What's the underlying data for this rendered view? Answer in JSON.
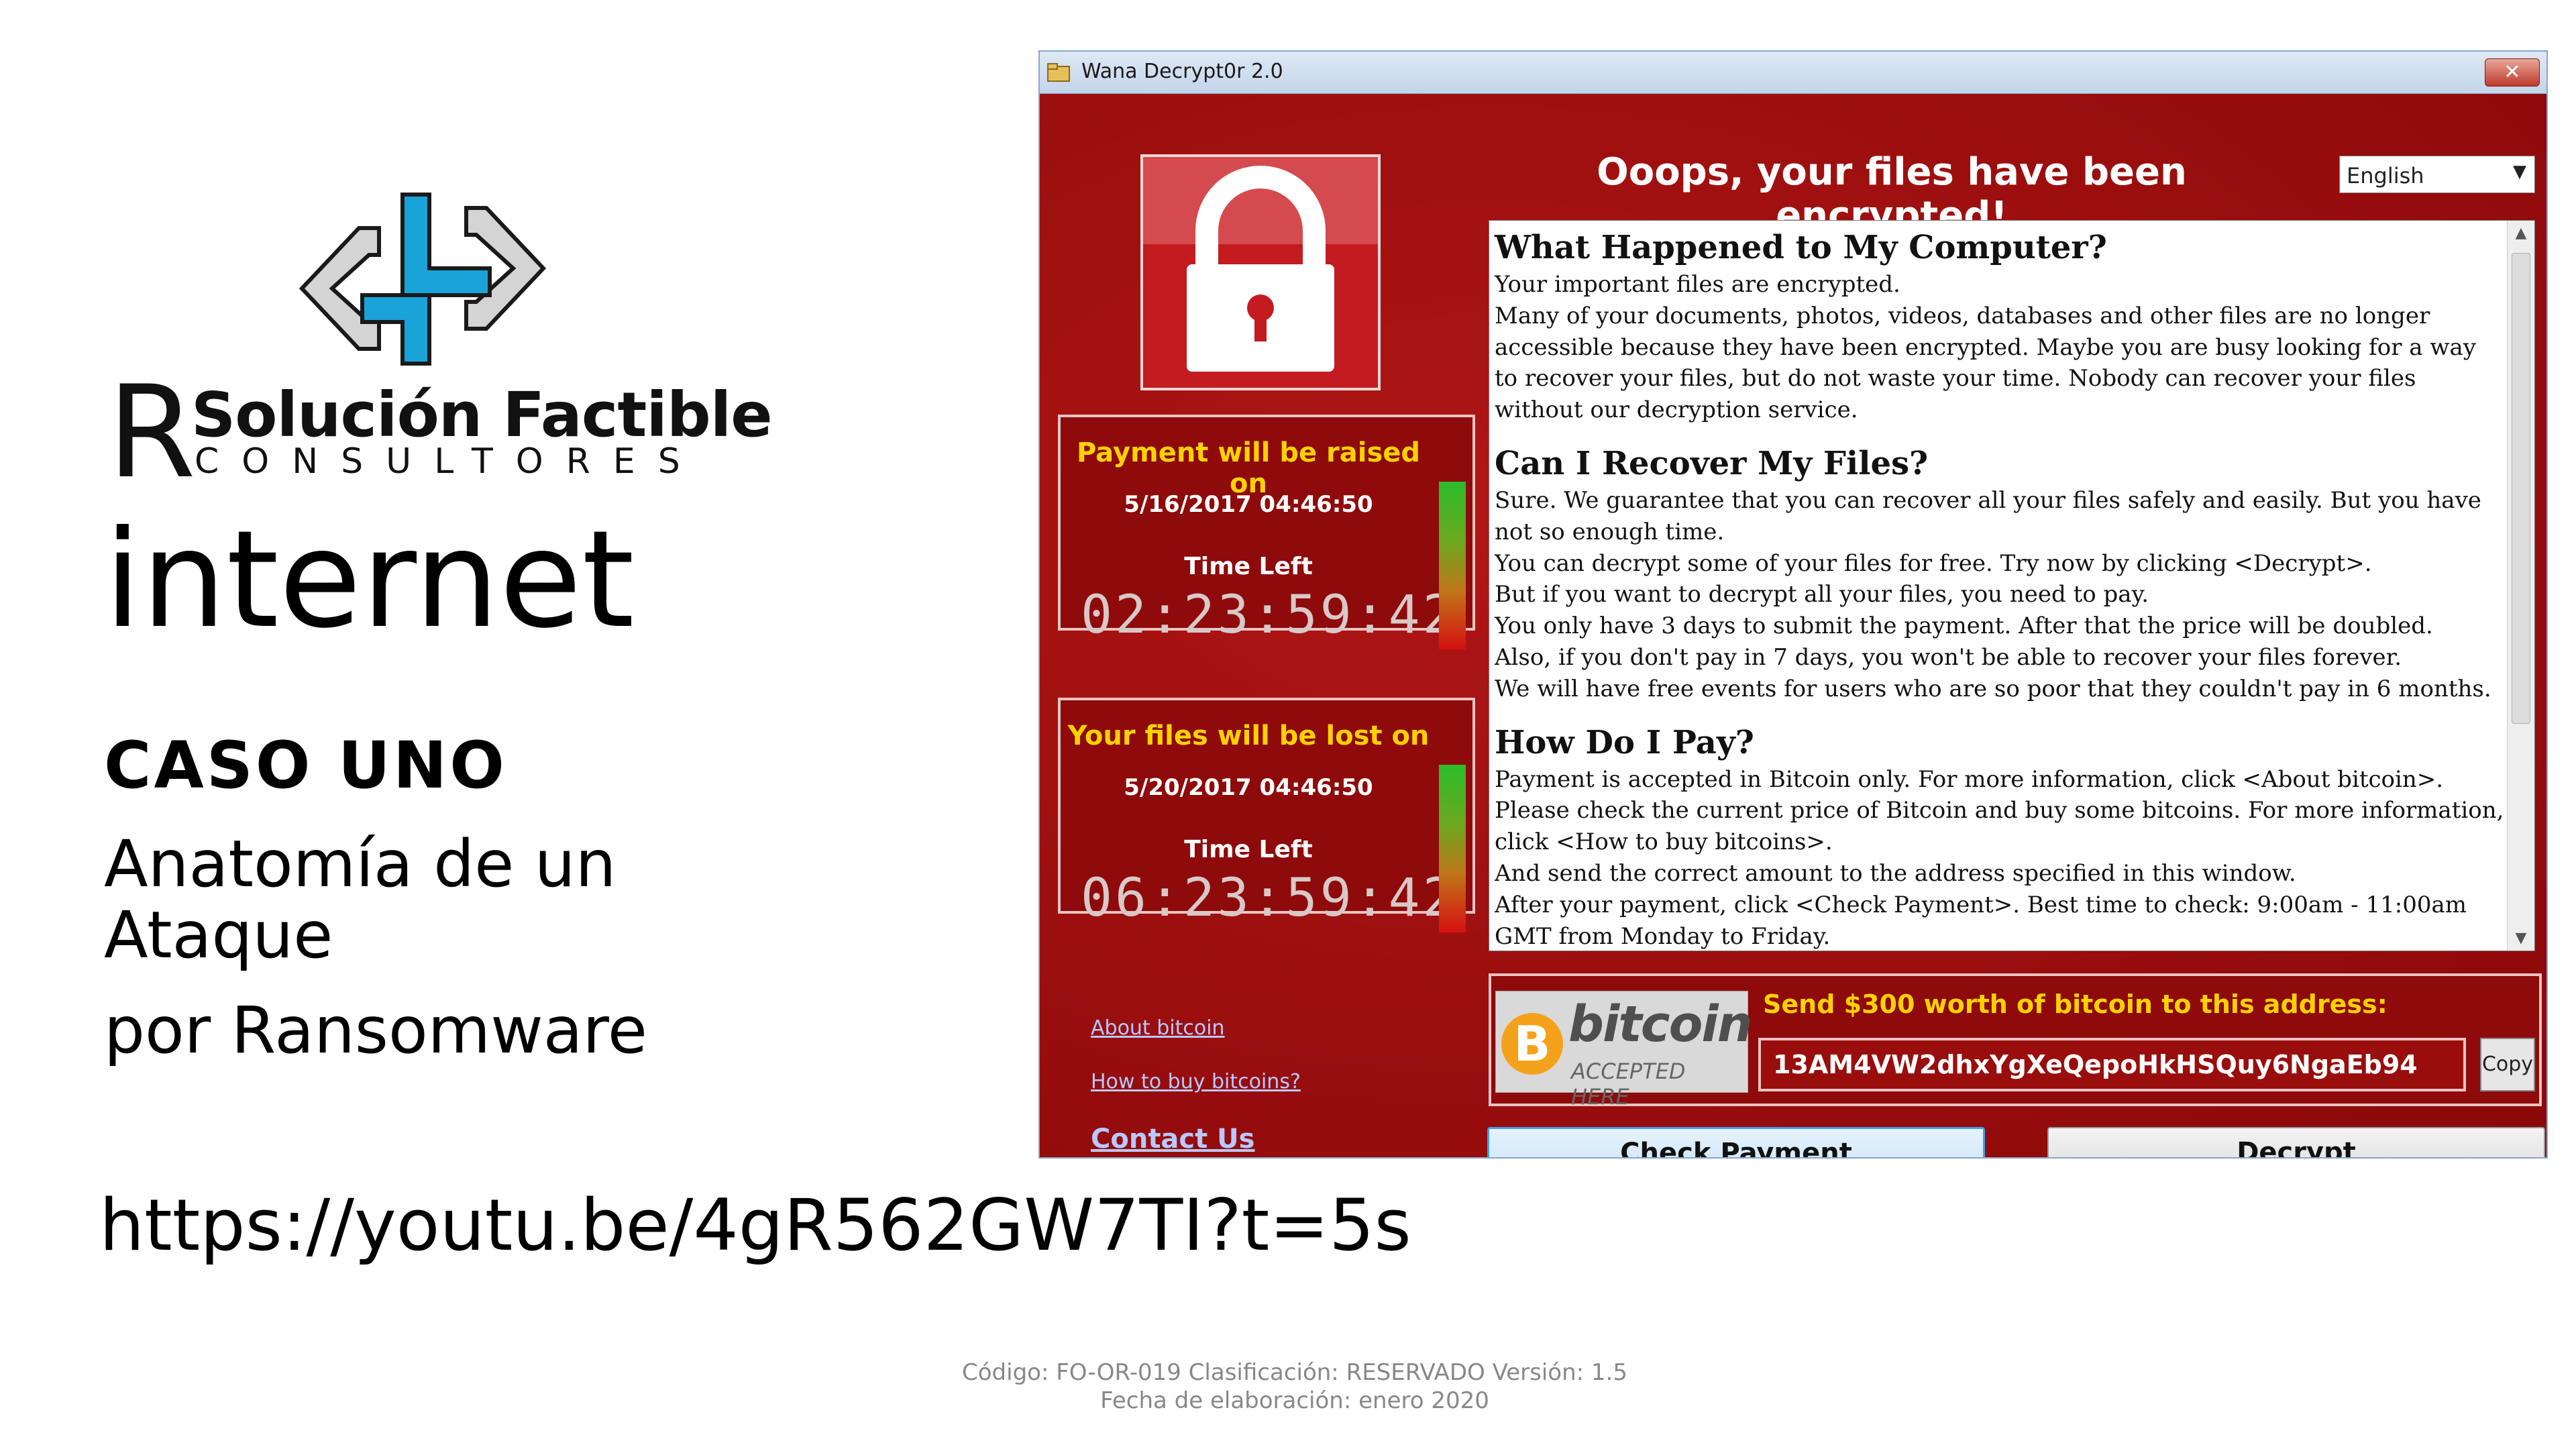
{
  "slide": {
    "logo": {
      "brand_letter": "R",
      "name": "Solución Factible",
      "subtitle": "CONSULTORES",
      "colors": {
        "blue": "#1aa3d9",
        "gray": "#d4d4d4",
        "outline": "#1a1a1a"
      }
    },
    "title": "internet",
    "case": "CASO UNO",
    "subtitle_line1": "Anatomía de un Ataque",
    "subtitle_line2": "por Ransomware",
    "url": "https://youtu.be/4gR562GW7TI?t=5s",
    "footer_line1": "Código: FO-OR-019   Clasificación: RESERVADO    Versión: 1.5",
    "footer_line2": "Fecha de elaboración: enero 2020"
  },
  "window": {
    "title": "Wana Decrypt0r 2.0",
    "close_label": "✕",
    "header": "Ooops, your files have been encrypted!",
    "language": "English",
    "lock_icon": "padlock-icon",
    "timer1": {
      "label": "Payment will be raised on",
      "date": "5/16/2017 04:46:50",
      "time_left_label": "Time Left",
      "countdown": "02:23:59:42"
    },
    "timer2": {
      "label": "Your files will be lost on",
      "date": "5/20/2017 04:46:50",
      "time_left_label": "Time Left",
      "countdown": "06:23:59:42"
    },
    "links": {
      "about_bitcoin": "About bitcoin",
      "how_to_buy": "How to buy bitcoins?",
      "contact_us": "Contact Us"
    },
    "sections": [
      {
        "heading": "What Happened to My Computer?",
        "lines": [
          "Your important files are encrypted.",
          "Many of your documents, photos, videos, databases and other files are no longer accessible because they have been encrypted. Maybe you are busy looking for a way to recover your files, but do not waste your time. Nobody can recover your files without our decryption service."
        ]
      },
      {
        "heading": "Can I Recover My Files?",
        "lines": [
          "Sure. We guarantee that you can recover all your files safely and easily. But you have not so enough time.",
          "You can decrypt some of your files for free. Try now by clicking <Decrypt>.",
          "But if you want to decrypt all your files, you need to pay.",
          "You only have 3 days to submit the payment. After that the price will be doubled.",
          "Also, if you don't pay in 7 days, you won't be able to recover your files forever.",
          "We will have free events for users who are so poor that they couldn't pay in 6 months."
        ]
      },
      {
        "heading": "How Do I Pay?",
        "lines": [
          "Payment is accepted in Bitcoin only. For more information, click <About bitcoin>.",
          "Please check the current price of Bitcoin and buy some bitcoins. For more information, click <How to buy bitcoins>.",
          "And send the correct amount to the address specified in this window.",
          "After your payment, click <Check Payment>. Best time to check: 9:00am - 11:00am",
          "GMT from Monday to Friday."
        ]
      }
    ],
    "payment": {
      "bitcoin_word": "bitcoin",
      "bitcoin_sub": "ACCEPTED HERE",
      "coin_symbol": "B",
      "send_label": "Send $300 worth of bitcoin to this address:",
      "address": "13AM4VW2dhxYgXeQepoHkHSQuy6NgaEb94",
      "copy_label": "Copy"
    },
    "buttons": {
      "check_payment": "Check Payment",
      "decrypt": "Decrypt"
    },
    "colors": {
      "window_red": "#9e0b0b",
      "accent_yellow": "#ffd200",
      "link_blue": "#b8c8ff"
    }
  }
}
